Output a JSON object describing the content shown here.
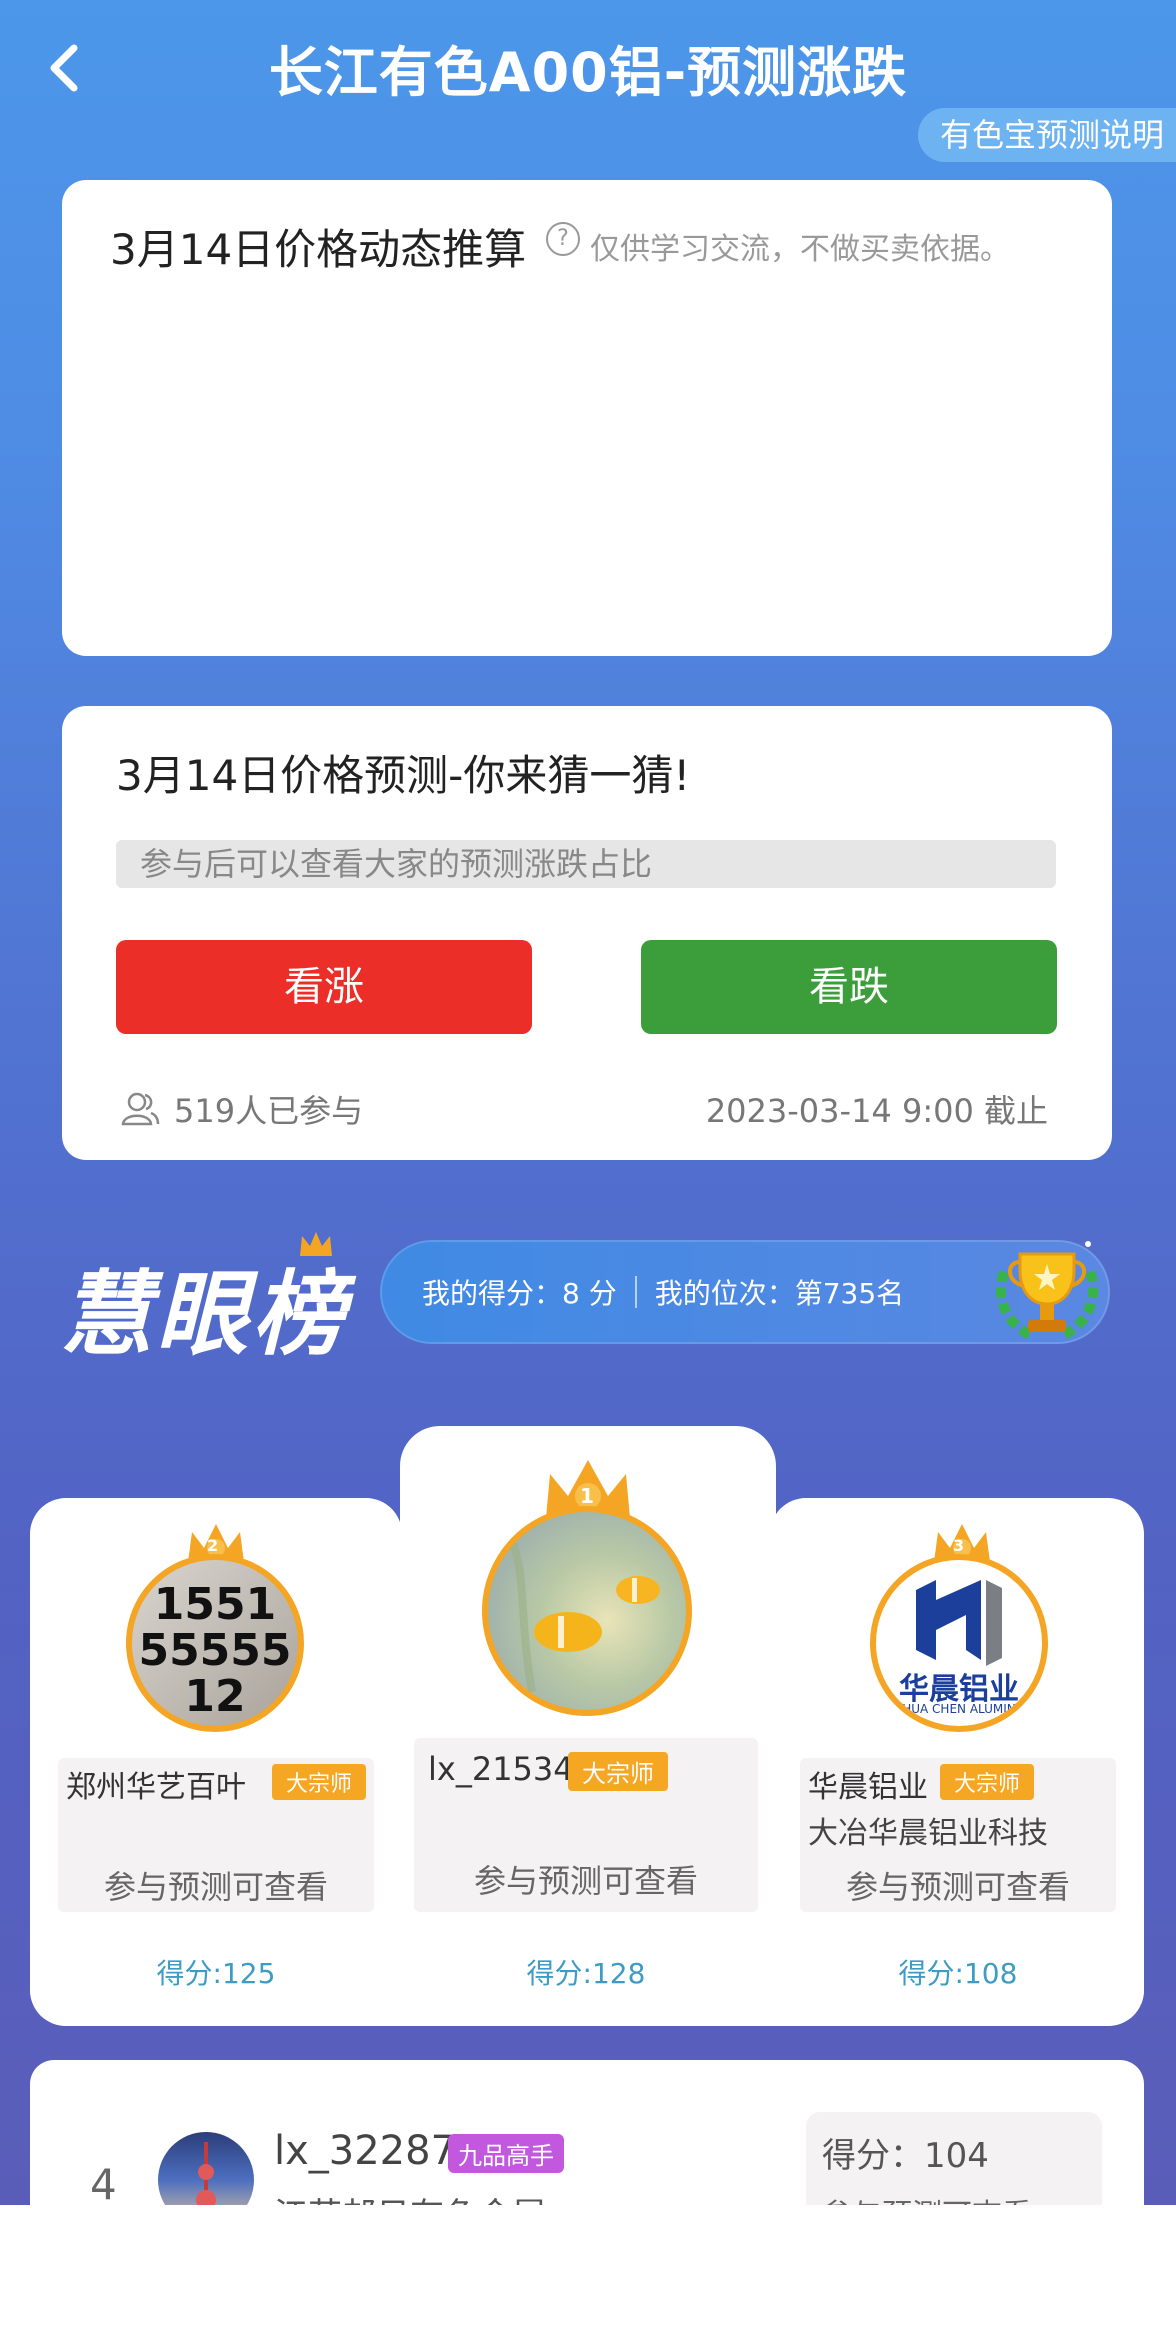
{
  "header": {
    "title": "长江有色A00铝-预测涨跌",
    "explain_label": "有色宝预测说明"
  },
  "trend_card": {
    "title": "3月14日价格动态推算",
    "note": "仅供学习交流，不做买卖依据。"
  },
  "predict_card": {
    "title": "3月14日价格预测-你来猜一猜!",
    "hint": "参与后可以查看大家的预测涨跌占比",
    "up_label": "看涨",
    "down_label": "看跌",
    "participants": "519人已参与",
    "deadline": "2023-03-14   9:00 截止"
  },
  "ranking": {
    "logo": "慧眼榜",
    "my_score": "我的得分：8 分",
    "my_rank": "我的位次：第735名",
    "podium": [
      {
        "rank": "2",
        "avatar_text": [
          "1551",
          "55555",
          "12"
        ],
        "name": "郑州华艺百叶",
        "badge": "大宗师",
        "company": "",
        "view": "参与预测可查看",
        "score": "得分:125"
      },
      {
        "rank": "1",
        "name": "lx_21534",
        "badge": "大宗师",
        "company": "",
        "view": "参与预测可查看",
        "score": "得分:128"
      },
      {
        "rank": "3",
        "avatar_text": [
          "华晨铝业",
          "HUA CHEN ALUMIN"
        ],
        "name": "华晨铝业",
        "badge": "大宗师",
        "company": "大冶华晨铝业科技",
        "view": "参与预测可查看",
        "score": "得分:108"
      }
    ],
    "row4": {
      "rank": "4",
      "name": "lx_32287",
      "badge": "九品高手",
      "company": "江苏邮日有色金属",
      "score": "得分：104",
      "view": "参与预测可查看"
    }
  },
  "colors": {
    "up": "#eb2e27",
    "down": "#3c9e3a",
    "gold": "#f5a524",
    "score": "#3e9bc4"
  }
}
